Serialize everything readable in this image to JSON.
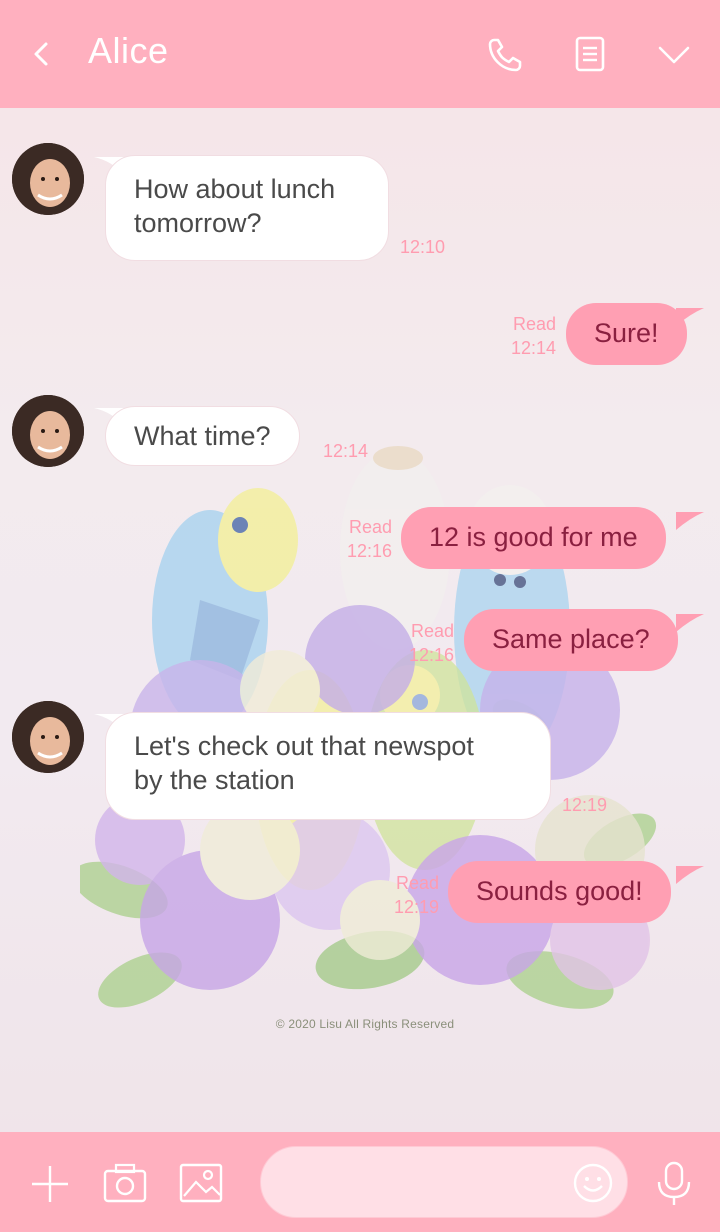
{
  "header": {
    "back_icon": "chevron-left-icon",
    "title": "Alice",
    "icons": [
      "phone-icon",
      "notes-icon",
      "chevron-down-icon"
    ]
  },
  "messages": [
    {
      "side": "in",
      "text": "How about lunch\ntomorrow?",
      "time": "12:10"
    },
    {
      "side": "out",
      "text": "Sure!",
      "read": "Read",
      "time": "12:14"
    },
    {
      "side": "in",
      "text": "What time?",
      "time": "12:14"
    },
    {
      "side": "out",
      "text": "12 is good for me",
      "read": "Read",
      "time": "12:16"
    },
    {
      "side": "out",
      "text": "Same place?",
      "read": "Read",
      "time": "12:16"
    },
    {
      "side": "in",
      "text": "Let's check out that newspot\nby the station",
      "time": "12:19"
    },
    {
      "side": "out",
      "text": "Sounds good!",
      "read": "Read",
      "time": "12:19"
    }
  ],
  "background": {
    "copyright": "© 2020 Lisu All Rights Reserved"
  },
  "footer": {
    "icons": [
      "plus-icon",
      "camera-icon",
      "image-icon",
      "emoji-icon",
      "microphone-icon"
    ],
    "input_placeholder": ""
  },
  "colors": {
    "header": "#ffb0bf",
    "outgoing_bubble": "#ff9fb3",
    "outgoing_text": "#8a2040",
    "meta_text": "#ff9cb0"
  }
}
